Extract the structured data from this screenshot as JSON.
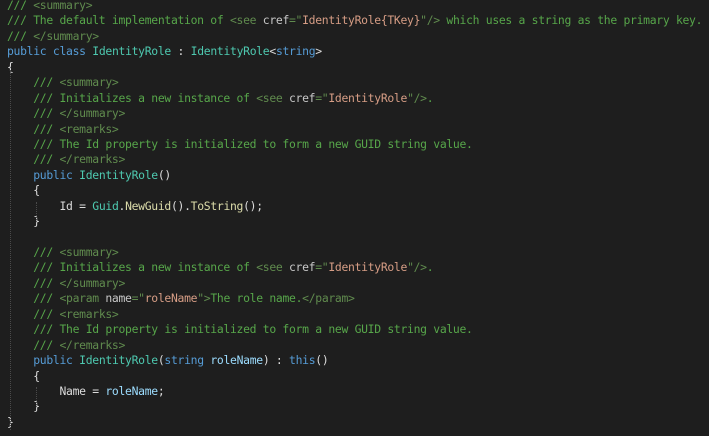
{
  "editor": {
    "theme": {
      "background": "#1e1e1e",
      "comment": "#57a64a",
      "xml_tag": "#608b4e",
      "keyword": "#569cd6",
      "type": "#4ec9b0",
      "method": "#dcdcaa",
      "parameter": "#9cdcfe",
      "string": "#d69d85",
      "plain": "#dcdcdc"
    },
    "lines": [
      [
        {
          "t": "comment",
          "v": "/// "
        },
        {
          "t": "xmltag",
          "v": "<summary>"
        }
      ],
      [
        {
          "t": "comment",
          "v": "/// The default implementation of "
        },
        {
          "t": "xmltag",
          "v": "<see "
        },
        {
          "t": "attr",
          "v": "cref"
        },
        {
          "t": "xmltag",
          "v": "=\""
        },
        {
          "t": "attrval",
          "v": "IdentityRole{TKey}"
        },
        {
          "t": "xmltag",
          "v": "\"/>"
        },
        {
          "t": "comment",
          "v": " which uses a string as the primary key."
        }
      ],
      [
        {
          "t": "comment",
          "v": "/// "
        },
        {
          "t": "xmltag",
          "v": "</summary>"
        }
      ],
      [
        {
          "t": "keyword",
          "v": "public"
        },
        {
          "t": "plain",
          "v": " "
        },
        {
          "t": "keyword",
          "v": "class"
        },
        {
          "t": "plain",
          "v": " "
        },
        {
          "t": "type",
          "v": "IdentityRole"
        },
        {
          "t": "plain",
          "v": " : "
        },
        {
          "t": "type",
          "v": "IdentityRole"
        },
        {
          "t": "punct",
          "v": "<"
        },
        {
          "t": "keyword",
          "v": "string"
        },
        {
          "t": "punct",
          "v": ">"
        }
      ],
      [
        {
          "t": "punct",
          "v": "{"
        }
      ],
      [
        {
          "t": "plain",
          "v": "    "
        },
        {
          "t": "comment",
          "v": "/// "
        },
        {
          "t": "xmltag",
          "v": "<summary>"
        }
      ],
      [
        {
          "t": "plain",
          "v": "    "
        },
        {
          "t": "comment",
          "v": "/// Initializes a new instance of "
        },
        {
          "t": "xmltag",
          "v": "<see "
        },
        {
          "t": "attr",
          "v": "cref"
        },
        {
          "t": "xmltag",
          "v": "=\""
        },
        {
          "t": "attrval",
          "v": "IdentityRole"
        },
        {
          "t": "xmltag",
          "v": "\"/>"
        },
        {
          "t": "comment",
          "v": "."
        }
      ],
      [
        {
          "t": "plain",
          "v": "    "
        },
        {
          "t": "comment",
          "v": "/// "
        },
        {
          "t": "xmltag",
          "v": "</summary>"
        }
      ],
      [
        {
          "t": "plain",
          "v": "    "
        },
        {
          "t": "comment",
          "v": "/// "
        },
        {
          "t": "xmltag",
          "v": "<remarks>"
        }
      ],
      [
        {
          "t": "plain",
          "v": "    "
        },
        {
          "t": "comment",
          "v": "/// The Id property is initialized to form a new GUID string value."
        }
      ],
      [
        {
          "t": "plain",
          "v": "    "
        },
        {
          "t": "comment",
          "v": "/// "
        },
        {
          "t": "xmltag",
          "v": "</remarks>"
        }
      ],
      [
        {
          "t": "plain",
          "v": "    "
        },
        {
          "t": "keyword",
          "v": "public"
        },
        {
          "t": "plain",
          "v": " "
        },
        {
          "t": "type",
          "v": "IdentityRole"
        },
        {
          "t": "punct",
          "v": "()"
        }
      ],
      [
        {
          "t": "plain",
          "v": "    "
        },
        {
          "t": "punct",
          "v": "{"
        }
      ],
      [
        {
          "t": "plain",
          "v": "        Id = "
        },
        {
          "t": "type",
          "v": "Guid"
        },
        {
          "t": "punct",
          "v": "."
        },
        {
          "t": "method",
          "v": "NewGuid"
        },
        {
          "t": "punct",
          "v": "()."
        },
        {
          "t": "method",
          "v": "ToString"
        },
        {
          "t": "punct",
          "v": "();"
        }
      ],
      [
        {
          "t": "plain",
          "v": "    "
        },
        {
          "t": "punct",
          "v": "}"
        }
      ],
      [
        {
          "t": "plain",
          "v": ""
        }
      ],
      [
        {
          "t": "plain",
          "v": "    "
        },
        {
          "t": "comment",
          "v": "/// "
        },
        {
          "t": "xmltag",
          "v": "<summary>"
        }
      ],
      [
        {
          "t": "plain",
          "v": "    "
        },
        {
          "t": "comment",
          "v": "/// Initializes a new instance of "
        },
        {
          "t": "xmltag",
          "v": "<see "
        },
        {
          "t": "attr",
          "v": "cref"
        },
        {
          "t": "xmltag",
          "v": "=\""
        },
        {
          "t": "attrval",
          "v": "IdentityRole"
        },
        {
          "t": "xmltag",
          "v": "\"/>"
        },
        {
          "t": "comment",
          "v": "."
        }
      ],
      [
        {
          "t": "plain",
          "v": "    "
        },
        {
          "t": "comment",
          "v": "/// "
        },
        {
          "t": "xmltag",
          "v": "</summary>"
        }
      ],
      [
        {
          "t": "plain",
          "v": "    "
        },
        {
          "t": "comment",
          "v": "/// "
        },
        {
          "t": "xmltag",
          "v": "<param "
        },
        {
          "t": "attr",
          "v": "name"
        },
        {
          "t": "xmltag",
          "v": "=\""
        },
        {
          "t": "attrval",
          "v": "roleName"
        },
        {
          "t": "xmltag",
          "v": "\">"
        },
        {
          "t": "comment",
          "v": "The role name."
        },
        {
          "t": "xmltag",
          "v": "</param>"
        }
      ],
      [
        {
          "t": "plain",
          "v": "    "
        },
        {
          "t": "comment",
          "v": "/// "
        },
        {
          "t": "xmltag",
          "v": "<remarks>"
        }
      ],
      [
        {
          "t": "plain",
          "v": "    "
        },
        {
          "t": "comment",
          "v": "/// The Id property is initialized to form a new GUID string value."
        }
      ],
      [
        {
          "t": "plain",
          "v": "    "
        },
        {
          "t": "comment",
          "v": "/// "
        },
        {
          "t": "xmltag",
          "v": "</remarks>"
        }
      ],
      [
        {
          "t": "plain",
          "v": "    "
        },
        {
          "t": "keyword",
          "v": "public"
        },
        {
          "t": "plain",
          "v": " "
        },
        {
          "t": "type",
          "v": "IdentityRole"
        },
        {
          "t": "punct",
          "v": "("
        },
        {
          "t": "keyword",
          "v": "string"
        },
        {
          "t": "plain",
          "v": " "
        },
        {
          "t": "param",
          "v": "roleName"
        },
        {
          "t": "punct",
          "v": ") : "
        },
        {
          "t": "keyword",
          "v": "this"
        },
        {
          "t": "punct",
          "v": "()"
        }
      ],
      [
        {
          "t": "plain",
          "v": "    "
        },
        {
          "t": "punct",
          "v": "{"
        }
      ],
      [
        {
          "t": "plain",
          "v": "        Name = "
        },
        {
          "t": "param",
          "v": "roleName"
        },
        {
          "t": "punct",
          "v": ";"
        }
      ],
      [
        {
          "t": "plain",
          "v": "    "
        },
        {
          "t": "punct",
          "v": "}"
        }
      ],
      [
        {
          "t": "punct",
          "v": "}"
        }
      ]
    ]
  }
}
